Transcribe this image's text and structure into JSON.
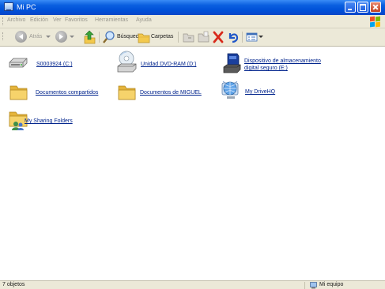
{
  "window": {
    "title": "Mi PC"
  },
  "menu": {
    "items": [
      "Archivo",
      "Edición",
      "Ver",
      "Favoritos",
      "Herramientas",
      "Ayuda"
    ]
  },
  "toolbar": {
    "back_label": "Atrás",
    "search_label": "Búsqueda",
    "folders_label": "Carpetas"
  },
  "items": [
    {
      "label": "S0003924 (C:)",
      "icon": "hard-drive-icon"
    },
    {
      "label": "Unidad DVD-RAM (D:)",
      "icon": "dvd-drive-icon"
    },
    {
      "label": "Dispositivo de almacenamiento digital seguro (E:)",
      "label_lines": [
        "Dispositivo de almacenamiento",
        "digital seguro (E:)"
      ],
      "icon": "secure-storage-icon"
    },
    {
      "label": "Documentos compartidos",
      "icon": "folder-icon"
    },
    {
      "label": "Documentos de MIGUEL",
      "icon": "folder-icon"
    },
    {
      "label": "My DriveHQ",
      "icon": "network-globe-icon"
    },
    {
      "label": "My Sharing Folders",
      "icon": "shared-folder-icon"
    }
  ],
  "status": {
    "left": "7 objetos",
    "right": "Mi equipo"
  },
  "colors": {
    "titlebar": "#0054e3",
    "chrome": "#ece9d8",
    "link": "#00238c",
    "folder": "#f6d36b"
  }
}
